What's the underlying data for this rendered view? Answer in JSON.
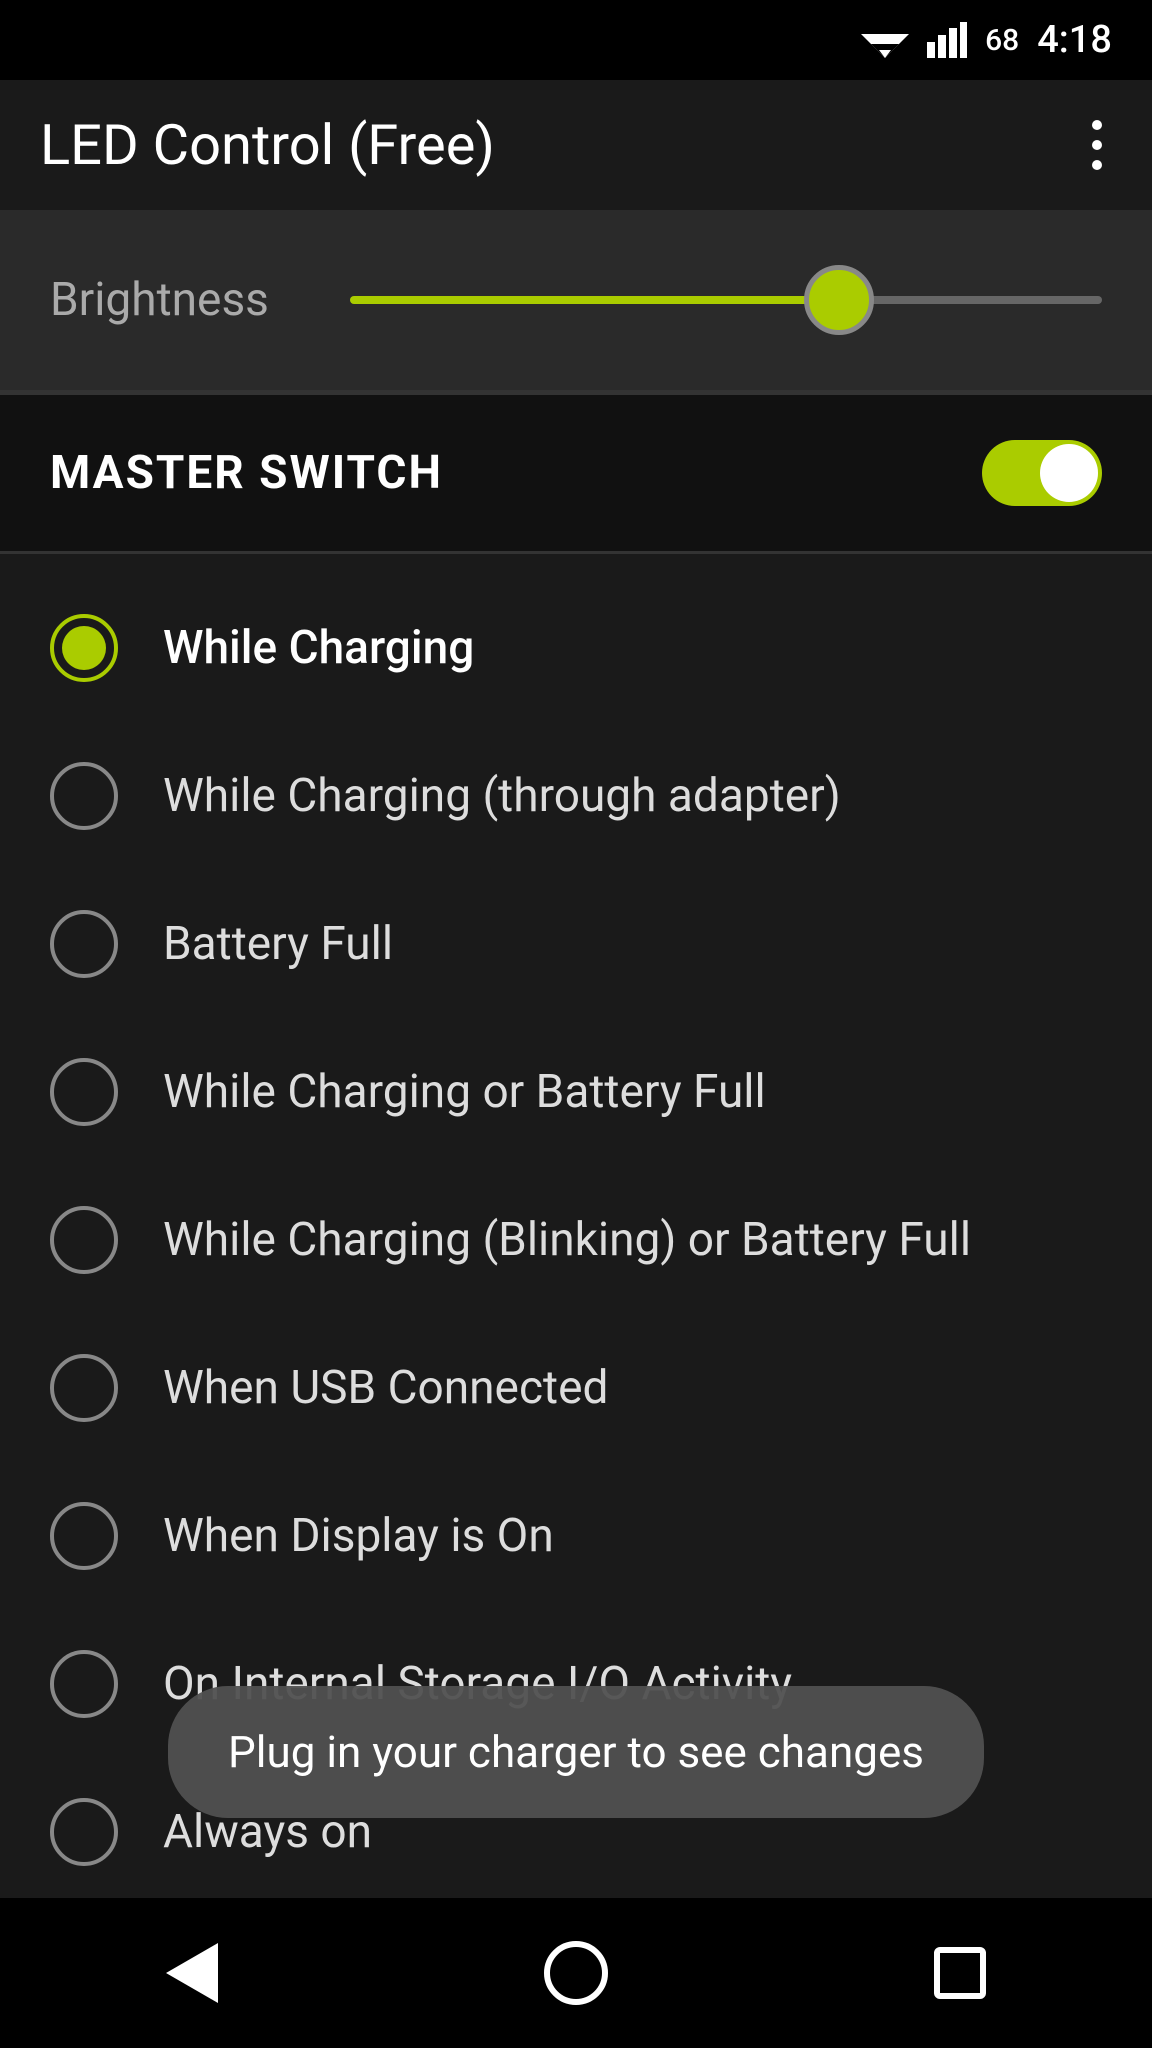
{
  "statusBar": {
    "time": "4:18",
    "battery": "68"
  },
  "titleBar": {
    "appTitle": "LED Control (Free)",
    "menuLabel": "menu"
  },
  "brightness": {
    "label": "Brightness",
    "sliderValue": 65
  },
  "masterSwitch": {
    "label": "MASTER SWITCH",
    "enabled": true
  },
  "options": [
    {
      "id": "while-charging",
      "label": "While Charging",
      "selected": true
    },
    {
      "id": "while-charging-adapter",
      "label": "While Charging (through adapter)",
      "selected": false
    },
    {
      "id": "battery-full",
      "label": "Battery Full",
      "selected": false
    },
    {
      "id": "while-charging-battery-full",
      "label": "While Charging or Battery Full",
      "selected": false
    },
    {
      "id": "while-charging-blinking",
      "label": "While Charging (Blinking) or Battery Full",
      "selected": false
    },
    {
      "id": "when-usb-connected",
      "label": "When USB Connected",
      "selected": false
    },
    {
      "id": "when-display-on",
      "label": "When Display is On",
      "selected": false
    },
    {
      "id": "on-internal-storage",
      "label": "On Internal Storage I/O Activity",
      "selected": false
    },
    {
      "id": "always-on",
      "label": "Always on",
      "selected": false
    }
  ],
  "toast": {
    "message": "Plug in your charger to see changes"
  },
  "navBar": {
    "backLabel": "back",
    "homeLabel": "home",
    "recentLabel": "recent apps"
  }
}
